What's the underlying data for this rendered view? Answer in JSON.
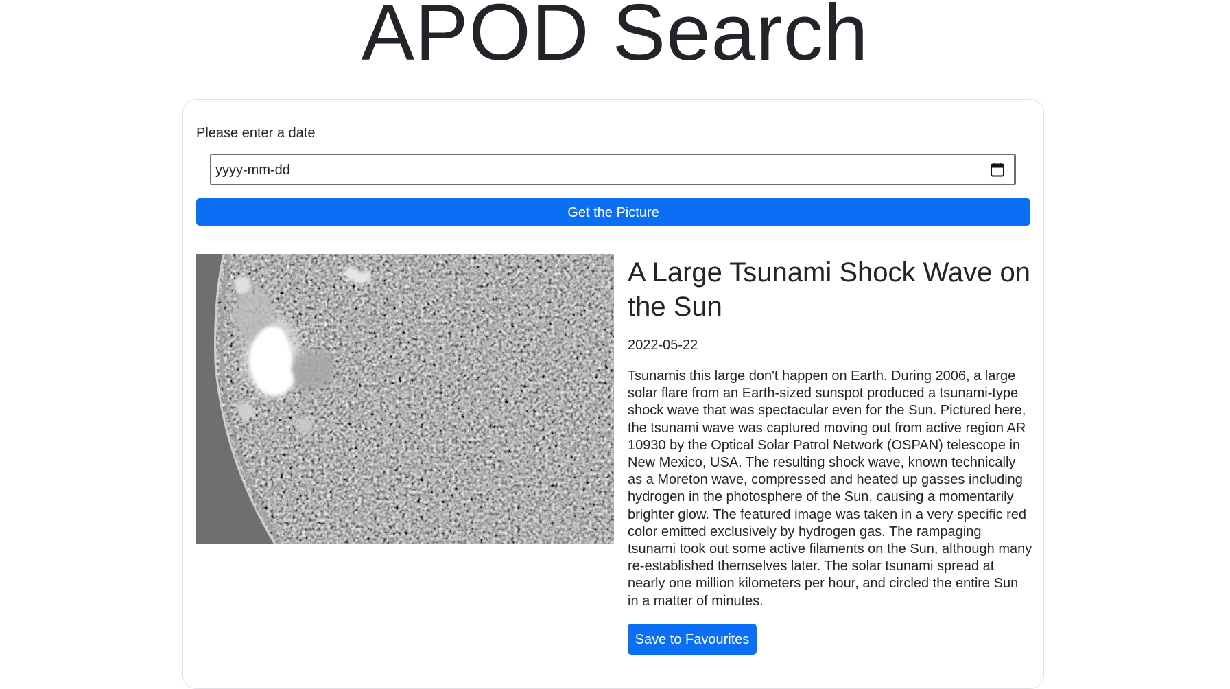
{
  "header": {
    "title": "APOD Search"
  },
  "search": {
    "label": "Please enter a date",
    "value": "",
    "placeholder": "yyyy-mm-dd",
    "submit_label": "Get the Picture"
  },
  "result": {
    "title": "A Large Tsunami Shock Wave on the Sun",
    "date": "2022-05-22",
    "explanation": "Tsunamis this large don't happen on Earth. During 2006, a large solar flare from an Earth-sized sunspot produced a tsunami-type shock wave that was spectacular even for the Sun. Pictured here, the tsunami wave was captured moving out from active region AR 10930 by the Optical Solar Patrol Network (OSPAN) telescope in New Mexico, USA. The resulting shock wave, known technically as a Moreton wave, compressed and heated up gasses including hydrogen in the photosphere of the Sun, causing a momentarily brighter glow. The featured image was taken in a very specific red color emitted exclusively by hydrogen gas. The rampaging tsunami took out some active filaments on the Sun, although many re-established themselves later. The solar tsunami spread at nearly one million kilometers per hour, and circled the entire Sun in a matter of minutes.",
    "save_label": "Save to Favourites"
  },
  "icons": {
    "date_picker": "calendar-icon",
    "apod_image": "solar-surface-image"
  },
  "colors": {
    "primary_button": "#0a6ff5",
    "text": "#212529",
    "card_border": "#dfe1e4"
  }
}
